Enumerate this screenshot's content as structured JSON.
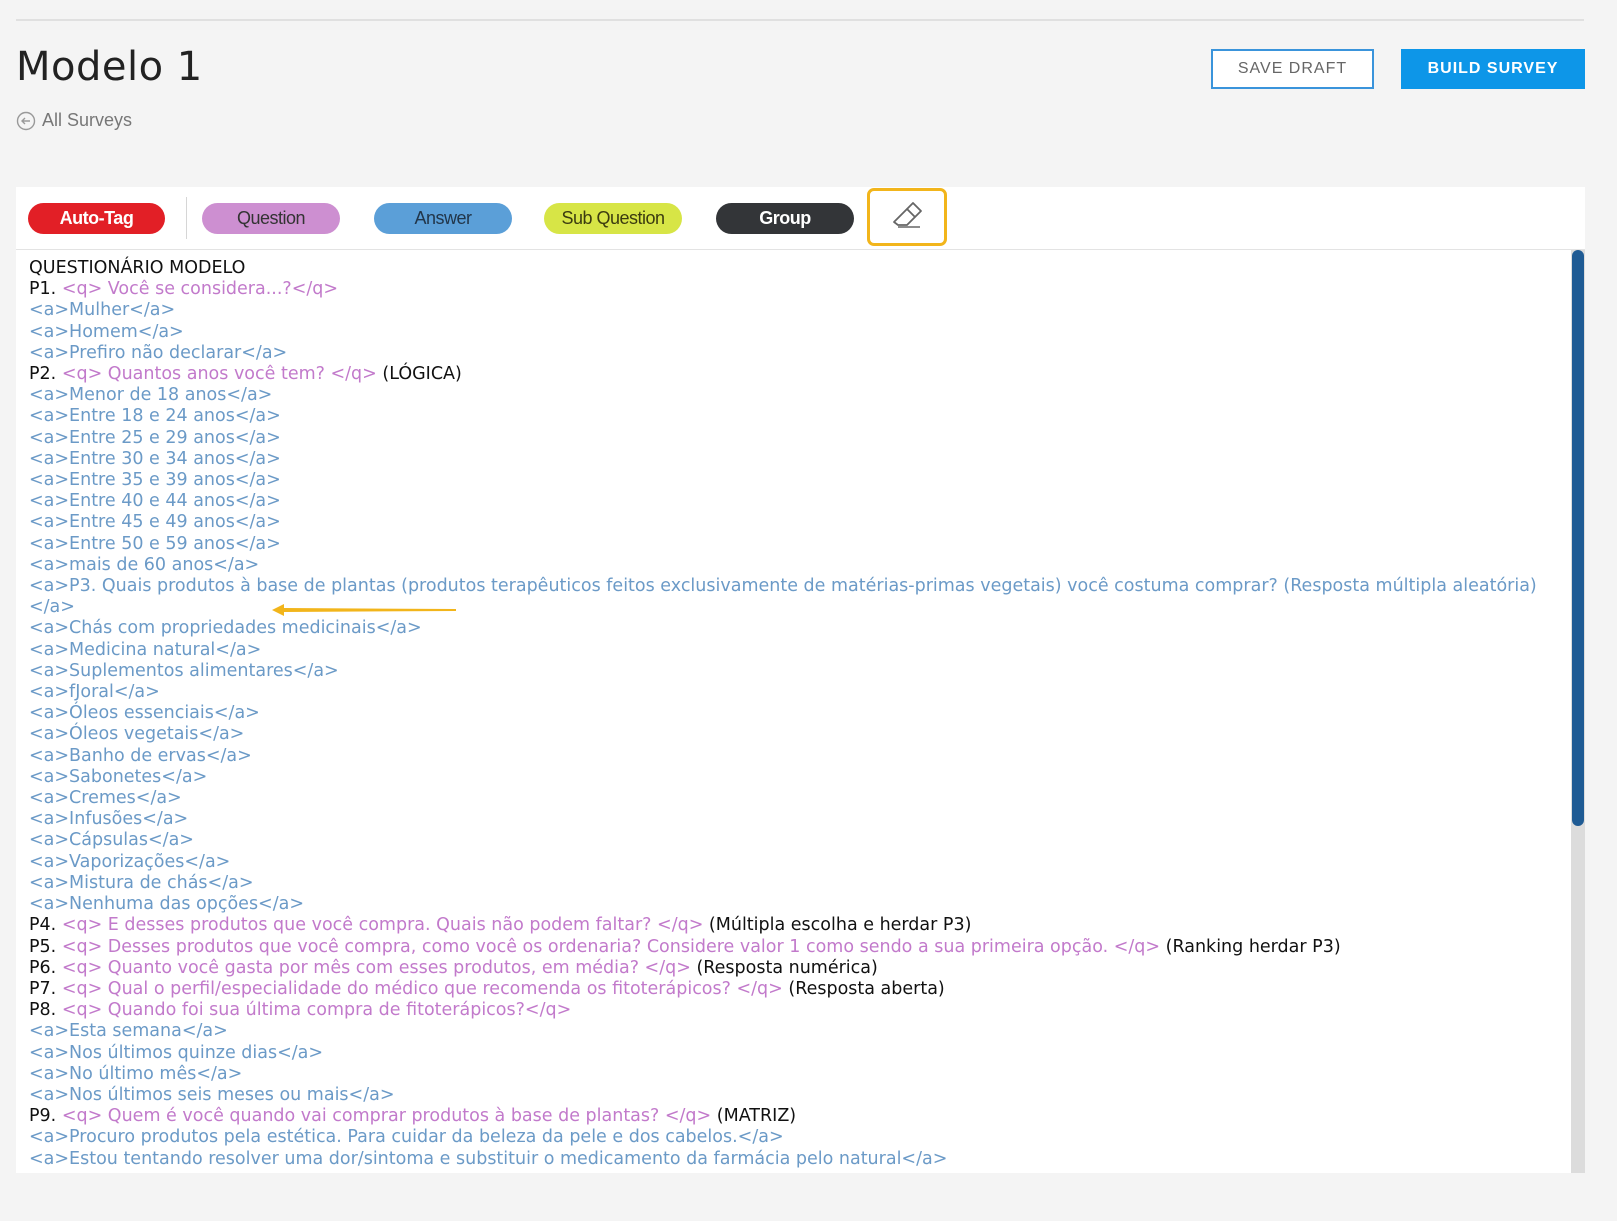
{
  "header": {
    "title": "Modelo 1",
    "back_label": "All Surveys",
    "save_draft": "SAVE DRAFT",
    "build_survey": "BUILD SURVEY"
  },
  "toolbar": {
    "autotag": "Auto-Tag",
    "question": "Question",
    "answer": "Answer",
    "sub_question": "Sub Question",
    "group": "Group",
    "eraser_icon": "eraser-icon"
  },
  "colors": {
    "autotag": "#e21f26",
    "question": "#cd8fd1",
    "answer": "#5b9fd8",
    "sub_question": "#d7e546",
    "group": "#333538",
    "highlight": "#f2b51b",
    "build": "#0d96e8"
  },
  "editor": {
    "lines": [
      {
        "type": "plain",
        "text": "QUESTIONÁRIO MODELO"
      },
      {
        "type": "q",
        "label": "P1. ",
        "text": "<q> Você se considera...?</q>",
        "tail": ""
      },
      {
        "type": "a",
        "text": "<a>Mulher</a>"
      },
      {
        "type": "a",
        "text": "<a>Homem</a>"
      },
      {
        "type": "a",
        "text": "<a>Prefiro não declarar</a>"
      },
      {
        "type": "q",
        "label": "P2. ",
        "text": "<q> Quantos anos você tem? </q>",
        "tail": " (LÓGICA)"
      },
      {
        "type": "a",
        "text": "<a>Menor de 18 anos</a>"
      },
      {
        "type": "a",
        "text": "<a>Entre 18 e 24 anos</a>"
      },
      {
        "type": "a",
        "text": "<a>Entre 25 e 29 anos</a>"
      },
      {
        "type": "a",
        "text": "<a>Entre 30 e 34 anos</a>"
      },
      {
        "type": "a",
        "text": "<a>Entre 35 e 39 anos</a>"
      },
      {
        "type": "a",
        "text": "<a>Entre 40 e 44 anos</a>"
      },
      {
        "type": "a",
        "text": "<a>Entre 45 e 49 anos</a>"
      },
      {
        "type": "a",
        "text": "<a>Entre 50 e 59 anos</a>"
      },
      {
        "type": "a",
        "text": "<a>mais de 60 anos</a>"
      },
      {
        "type": "a",
        "text": "<a>P3. Quais produtos à base de plantas (produtos terapêuticos feitos exclusivamente de matérias-primas vegetais) você costuma comprar? (Resposta múltipla aleatória)</a>"
      },
      {
        "type": "a",
        "text": "<a>Chás com propriedades medicinais</a>"
      },
      {
        "type": "a",
        "text": "<a>Medicina natural</a>"
      },
      {
        "type": "a",
        "text": "<a>Suplementos alimentares</a>"
      },
      {
        "type": "a",
        "text": "<a>fJoral</a>"
      },
      {
        "type": "a",
        "text": "<a>Óleos essenciais</a>"
      },
      {
        "type": "a",
        "text": "<a>Óleos vegetais</a>"
      },
      {
        "type": "a",
        "text": "<a>Banho de ervas</a>"
      },
      {
        "type": "a",
        "text": "<a>Sabonetes</a>"
      },
      {
        "type": "a",
        "text": "<a>Cremes</a>"
      },
      {
        "type": "a",
        "text": "<a>Infusões</a>"
      },
      {
        "type": "a",
        "text": "<a>Cápsulas</a>"
      },
      {
        "type": "a",
        "text": "<a>Vaporizações</a>"
      },
      {
        "type": "a",
        "text": "<a>Mistura de chás</a>"
      },
      {
        "type": "a",
        "text": "<a>Nenhuma das opções</a>"
      },
      {
        "type": "q",
        "label": "P4. ",
        "text": "<q> E desses produtos que você compra. Quais não podem faltar? </q>",
        "tail": " (Múltipla escolha e herdar P3)"
      },
      {
        "type": "q",
        "label": "P5. ",
        "text": "<q> Desses produtos que você compra, como você os ordenaria? Considere valor 1 como sendo a sua primeira opção. </q>",
        "tail": " (Ranking herdar P3)"
      },
      {
        "type": "q",
        "label": "P6. ",
        "text": "<q> Quanto você gasta por mês com esses produtos, em média? </q>",
        "tail": " (Resposta numérica)"
      },
      {
        "type": "q",
        "label": "P7. ",
        "text": "<q> Qual o perfil/especialidade do médico que recomenda os fitoterápicos? </q>",
        "tail": " (Resposta aberta)"
      },
      {
        "type": "q",
        "label": "P8. ",
        "text": "<q> Quando foi sua última compra de fitoterápicos?</q>",
        "tail": ""
      },
      {
        "type": "a",
        "text": "<a>Esta semana</a>"
      },
      {
        "type": "a",
        "text": "<a>Nos últimos quinze dias</a>"
      },
      {
        "type": "a",
        "text": "<a>No último mês</a>"
      },
      {
        "type": "a",
        "text": "<a>Nos últimos seis meses ou mais</a>"
      },
      {
        "type": "q",
        "label": "P9. ",
        "text": "<q> Quem é você quando vai comprar produtos à base de plantas? </q>",
        "tail": " (MATRIZ)"
      },
      {
        "type": "a",
        "text": "<a>Procuro produtos pela estética. Para cuidar da beleza da pele e dos cabelos.</a>"
      },
      {
        "type": "a",
        "text": "<a>Estou tentando resolver uma dor/sintoma e substituir o medicamento da farmácia pelo natural</a>"
      }
    ]
  }
}
